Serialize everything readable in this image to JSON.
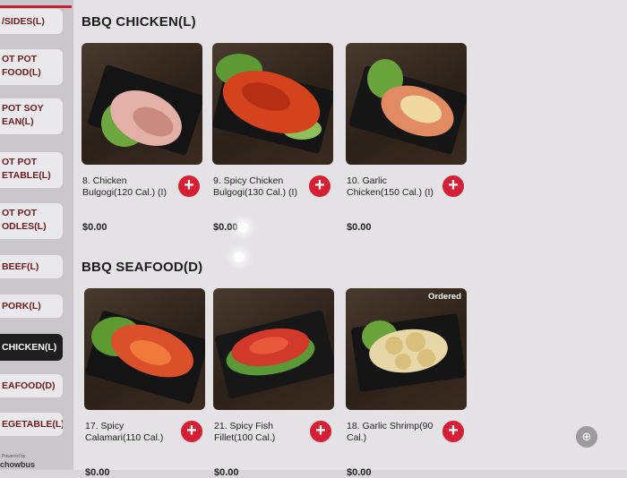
{
  "sidebar": {
    "items": [
      {
        "label": "/SIDES(L)",
        "active": false
      },
      {
        "label": "OT POT\nFOOD(L)",
        "active": false
      },
      {
        "label": "POT SOY\nEAN(L)",
        "active": false
      },
      {
        "label": "OT POT\nETABLE(L)",
        "active": false
      },
      {
        "label": "OT POT\nODLES(L)",
        "active": false
      },
      {
        "label": "BEEF(L)",
        "active": false
      },
      {
        "label": "PORK(L)",
        "active": false
      },
      {
        "label": "CHICKEN(L)",
        "active": true
      },
      {
        "label": "EAFOOD(D)",
        "active": false
      },
      {
        "label": "EGETABLE(L)",
        "active": false
      }
    ],
    "powered_by": "Powered by",
    "powered_logo": "chowbus"
  },
  "sections": [
    {
      "title": "BBQ CHICKEN(L)",
      "items": [
        {
          "name": "8. Chicken Bulgogi(120 Cal.) (I)",
          "price": "$0.00",
          "badge": ""
        },
        {
          "name": "9. Spicy Chicken Bulgogi(130 Cal.) (I)",
          "price": "$0.00",
          "badge": ""
        },
        {
          "name": "10. Garlic Chicken(150 Cal.) (I)",
          "price": "$0.00",
          "badge": ""
        }
      ]
    },
    {
      "title": "BBQ SEAFOOD(D)",
      "items": [
        {
          "name": "17. Spicy Calamari(110 Cal.)",
          "price": "$0.00",
          "badge": ""
        },
        {
          "name": "21. Spicy Fish Fillet(100 Cal.)",
          "price": "$0.00",
          "badge": ""
        },
        {
          "name": "18. Garlic Shrimp(90 Cal.)",
          "price": "$0.00",
          "badge": "Ordered"
        }
      ]
    }
  ],
  "add_button_glyph": "+",
  "zoom_glyph": "⊕",
  "icons": {
    "add": "plus-circle-icon",
    "zoom": "zoom-in-icon"
  },
  "colors": {
    "accent": "#d41f34",
    "active_nav": "#1e1e1f",
    "nav_text": "#6a1c1f"
  }
}
